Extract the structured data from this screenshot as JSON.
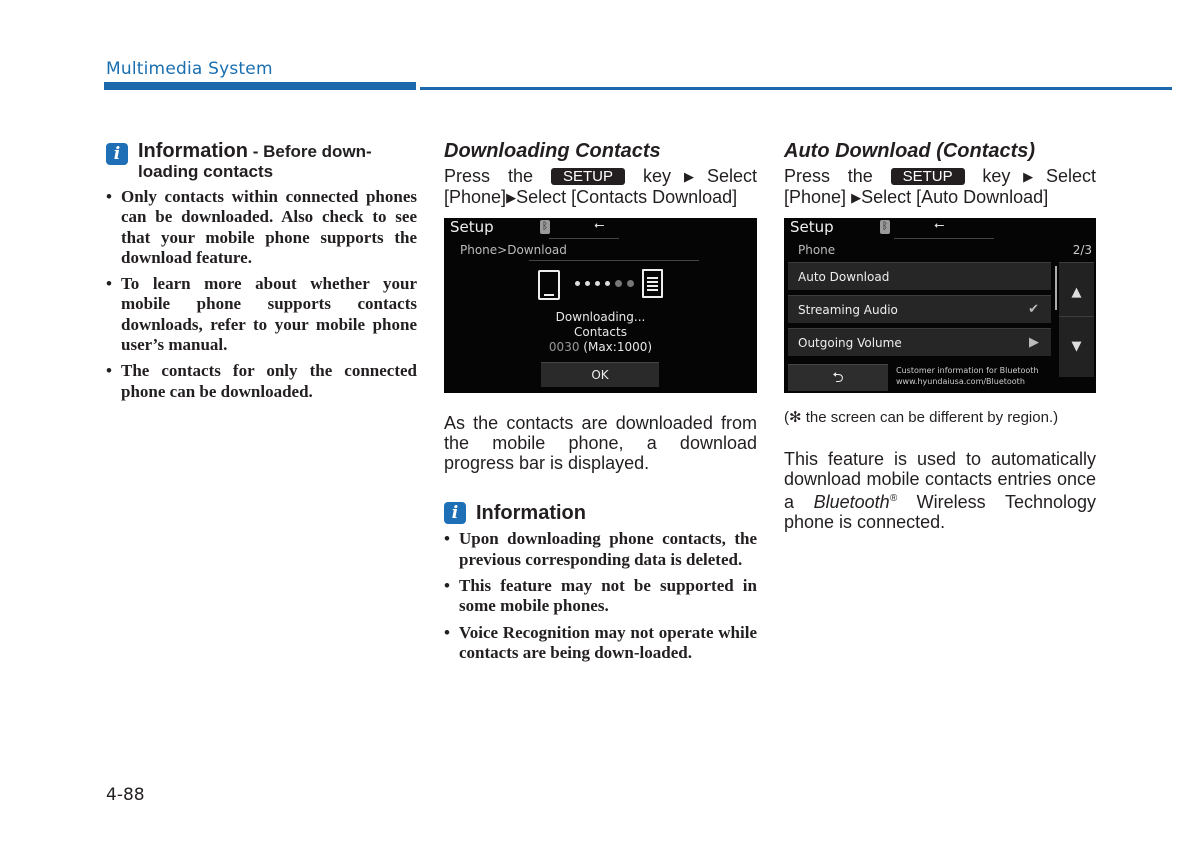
{
  "header": {
    "title": "Multimedia System"
  },
  "column1": {
    "info_title": "Information",
    "info_subtitle": " - Before down-",
    "info_subtitle_cont": "loading contacts",
    "bullets": [
      "Only contacts within connected phones can be downloaded. Also check to see that your mobile phone supports the download feature.",
      "To learn more about whether your mobile phone supports contacts downloads, refer to your mobile phone user’s manual.",
      "The contacts for only the connected phone can be downloaded."
    ]
  },
  "column2": {
    "section_title": "Downloading Contacts",
    "instr_press": "Press the",
    "setup_key": "SETUP",
    "instr_key": "key",
    "instr_select1": "Select",
    "instr_phone": "[Phone]",
    "instr_select2": "Select [Contacts Download]",
    "screen": {
      "title": "Setup",
      "bt_icon": "bluetooth-download-icon",
      "usb_icon": "usb-icon",
      "breadcrumb": "Phone>Download",
      "status_line1": "Downloading...",
      "status_line2": "Contacts",
      "count": "0030",
      "max": "(Max:1000)",
      "ok_label": "OK"
    },
    "description": "As the contacts are downloaded from the mobile phone, a download progress bar is displayed.",
    "info_title": "Information",
    "bullets": [
      "Upon downloading phone contacts, the previous corresponding data is deleted.",
      "This feature may not be supported in some mobile phones.",
      "Voice Recognition may not operate while contacts are being down-loaded."
    ]
  },
  "column3": {
    "section_title": "Auto Download (Contacts)",
    "instr_press": "Press the",
    "setup_key": "SETUP",
    "instr_key": "key",
    "instr_select1": "Select",
    "instr_phone": "[Phone]",
    "instr_select2": "Select [Auto Download]",
    "screen": {
      "title": "Setup",
      "breadcrumb": "Phone",
      "page_indicator": "2/3",
      "menu_items": [
        {
          "label": "Auto Download",
          "right": ""
        },
        {
          "label": "Streaming Audio",
          "right": "✔"
        },
        {
          "label": "Outgoing Volume",
          "right": "▶"
        }
      ],
      "up_arrow": "▲",
      "down_arrow": "▼",
      "back_icon": "⮌",
      "customer_info_line1": "Customer information for Bluetooth",
      "customer_info_line2": "www.hyundaiusa.com/Bluetooth"
    },
    "note": "(✻ the screen can be different by region.)",
    "desc_part1": "This feature is used to automatically download mobile contacts entries once a ",
    "desc_bluetooth": "Bluetooth",
    "desc_reg": "®",
    "desc_part2": " Wireless Technology phone is connected."
  },
  "page_number": "4-88"
}
